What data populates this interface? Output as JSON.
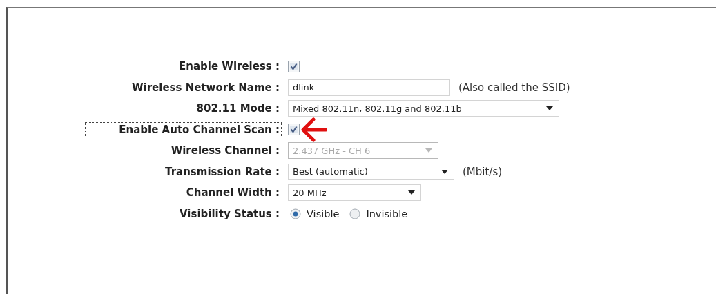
{
  "rows": [
    {
      "label": "Enable Wireless :",
      "kind": "checkbox",
      "checked": true,
      "focused": false,
      "annotated": false
    },
    {
      "label": "Wireless Network Name :",
      "kind": "text",
      "value": "dlink",
      "note": "(Also called the SSID)",
      "focused": false,
      "annotated": false
    },
    {
      "label": "802.11 Mode :",
      "kind": "select",
      "value": "Mixed 802.11n, 802.11g and 802.11b",
      "disabled": false,
      "focused": false,
      "annotated": false
    },
    {
      "label": "Enable Auto Channel Scan :",
      "kind": "checkbox",
      "checked": true,
      "focused": true,
      "annotated": true
    },
    {
      "label": "Wireless Channel :",
      "kind": "select",
      "value": "2.437 GHz - CH 6",
      "disabled": true,
      "focused": false,
      "annotated": false
    },
    {
      "label": "Transmission Rate :",
      "kind": "select",
      "value": "Best (automatic)",
      "disabled": false,
      "note": "(Mbit/s)",
      "focused": false,
      "annotated": false
    },
    {
      "label": "Channel Width :",
      "kind": "select",
      "value": "20 MHz",
      "disabled": false,
      "focused": false,
      "annotated": false
    },
    {
      "label": "Visibility Status :",
      "kind": "radio",
      "options": [
        {
          "label": "Visible",
          "selected": true
        },
        {
          "label": "Invisible",
          "selected": false
        }
      ],
      "focused": false,
      "annotated": false
    }
  ]
}
